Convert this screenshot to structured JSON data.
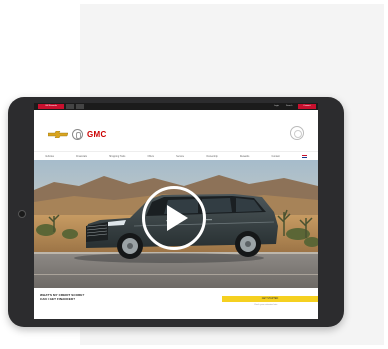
{
  "browser": {
    "active_tab_label": "GM Rewards",
    "tabs": [
      "",
      ""
    ],
    "util_links": [
      "Login",
      "Search"
    ],
    "cta_label": "Connect"
  },
  "brands": {
    "logos": [
      "chevrolet-logo",
      "buick-logo",
      "GMC"
    ],
    "gmc_wordmark": "GMC",
    "onstar": "onstar-logo"
  },
  "nav": {
    "items": [
      "Vehicles",
      "Financials",
      "Shopping Tools",
      "Offers",
      "Service",
      "Ownership",
      "Rewards",
      "Contact"
    ]
  },
  "hero": {
    "media": "suv-desert-video",
    "play_icon": "play-icon"
  },
  "promo": {
    "headline": "WHAT'S MY CREDIT SCORE? CAN I GET FINANCED?",
    "button_label": "GET STARTED",
    "subtext": "Check your estimated rate"
  },
  "colors": {
    "brand_red": "#c8102e",
    "cta_yellow": "#f5d020",
    "device_frame": "#2c2c2e"
  }
}
